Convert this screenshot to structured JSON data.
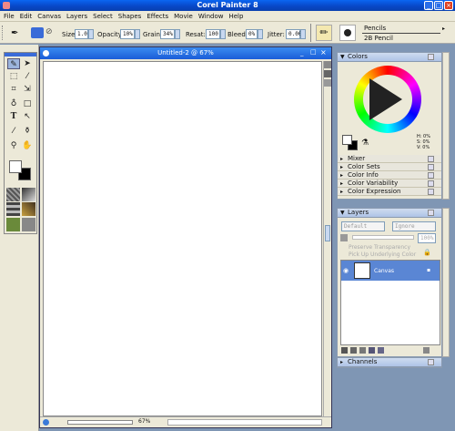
{
  "app": {
    "title": "Corel Painter 8"
  },
  "menu": [
    "File",
    "Edit",
    "Canvas",
    "Layers",
    "Select",
    "Shapes",
    "Effects",
    "Movie",
    "Window",
    "Help"
  ],
  "props": {
    "size_label": "Size:",
    "size": "1.0",
    "opacity_label": "Opacity:",
    "opacity": "10%",
    "grain_label": "Grain:",
    "grain": "34%",
    "resat_label": "Resat:",
    "resat": "100",
    "bleed_label": "Bleed:",
    "bleed": "0%",
    "jitter_label": "Jitter:",
    "jitter": "0.00"
  },
  "brush": {
    "category": "Pencils",
    "variant": "2B Pencil"
  },
  "document": {
    "title": "Untitled-2 @ 67%",
    "zoom": "67%"
  },
  "colors": {
    "title": "Colors",
    "h": "H: 0%",
    "s": "S: 0%",
    "v": "V: 0%",
    "sections": [
      "Mixer",
      "Color Sets",
      "Color Info",
      "Color Variability",
      "Color Expression"
    ]
  },
  "layers": {
    "title": "Layers",
    "composite": "Default",
    "method": "Ignore",
    "opacity": "100%",
    "preserve": "Preserve Transparency",
    "pickup": "Pick Up Underlying Color",
    "canvas_label": "Canvas"
  },
  "channels": {
    "title": "Channels"
  },
  "accent": "#0a5ee8"
}
